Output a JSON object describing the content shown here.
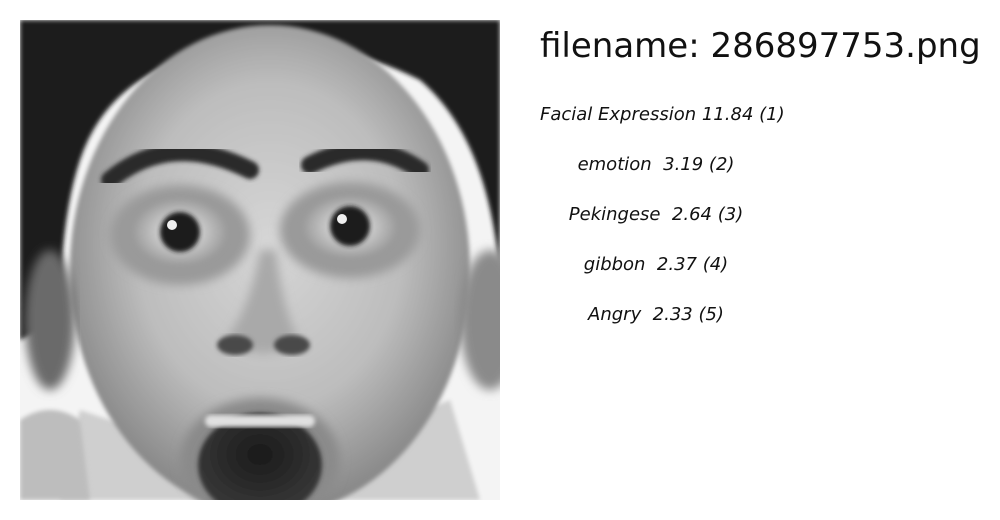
{
  "header": {
    "filename_text": "filename: 286897753.png"
  },
  "image": {
    "subject": "face-photo",
    "style": "grayscale"
  },
  "predictions": [
    {
      "text": "Facial Expression 11.84 (1)"
    },
    {
      "text": "emotion  3.19 (2)"
    },
    {
      "text": "Pekingese  2.64 (3)"
    },
    {
      "text": "gibbon  2.37 (4)"
    },
    {
      "text": "Angry  2.33 (5)"
    }
  ]
}
